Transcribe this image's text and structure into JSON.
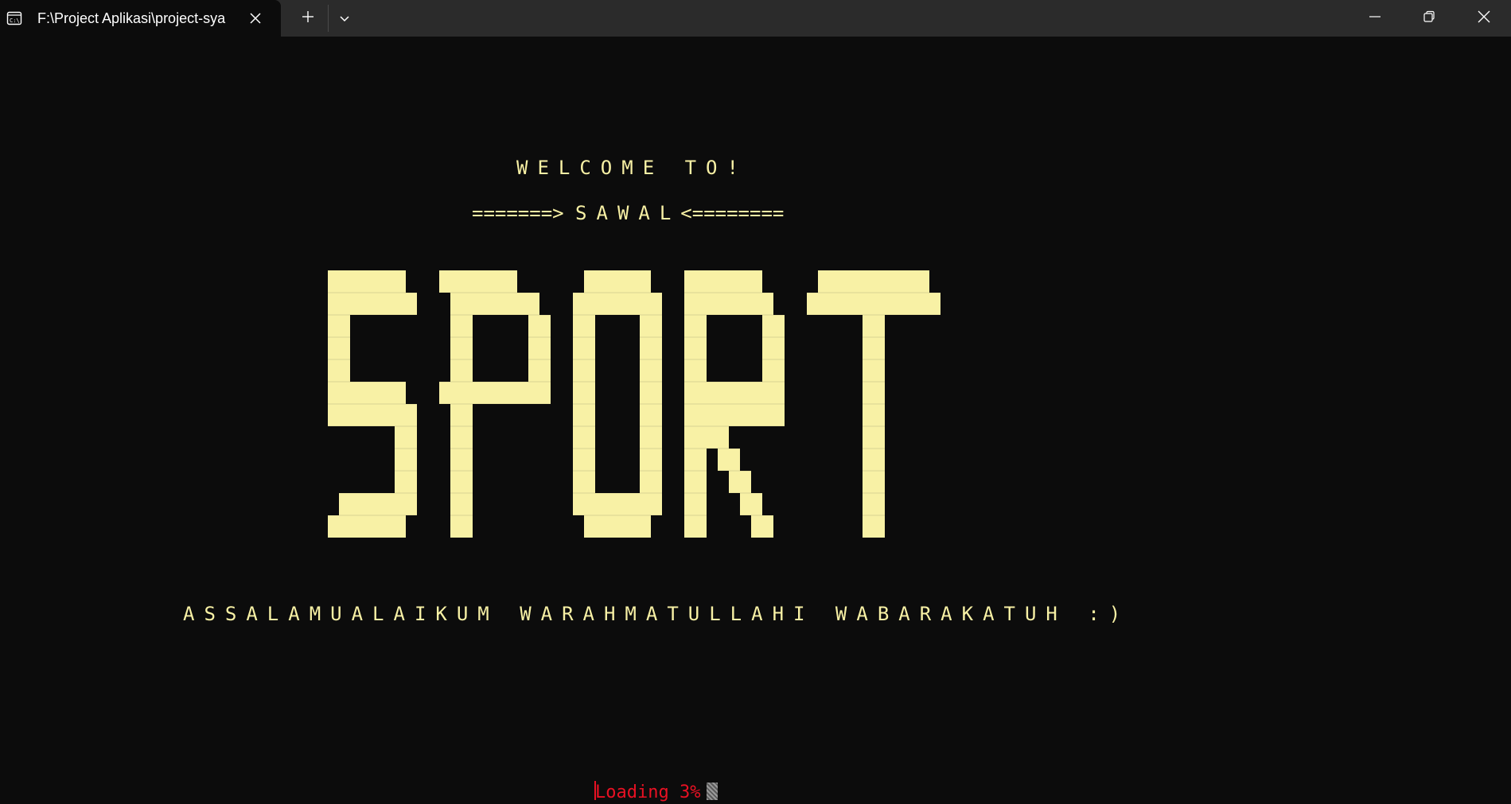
{
  "window": {
    "tab_title": "F:\\Project Aplikasi\\project-sya",
    "tab_icon": "terminal-icon",
    "new_tab_icon": "plus-icon",
    "dropdown_icon": "chevron-down-icon",
    "minimize_icon": "minimize-icon",
    "maximize_icon": "restore-icon",
    "close_icon": "close-icon"
  },
  "terminal": {
    "welcome": "WELCOME TO!",
    "sawal_left": "=======>",
    "sawal_mid": "SAWAL",
    "sawal_right": "<========",
    "logo_text": "SPORT",
    "greeting": "ASSALAMUALAIKUM WARAHMATULLAHI WABARAKATUH :)",
    "loading": "Loading 3%",
    "text_color": "#f8f1a5",
    "loading_color": "#e81123",
    "background": "#0c0c0c"
  }
}
